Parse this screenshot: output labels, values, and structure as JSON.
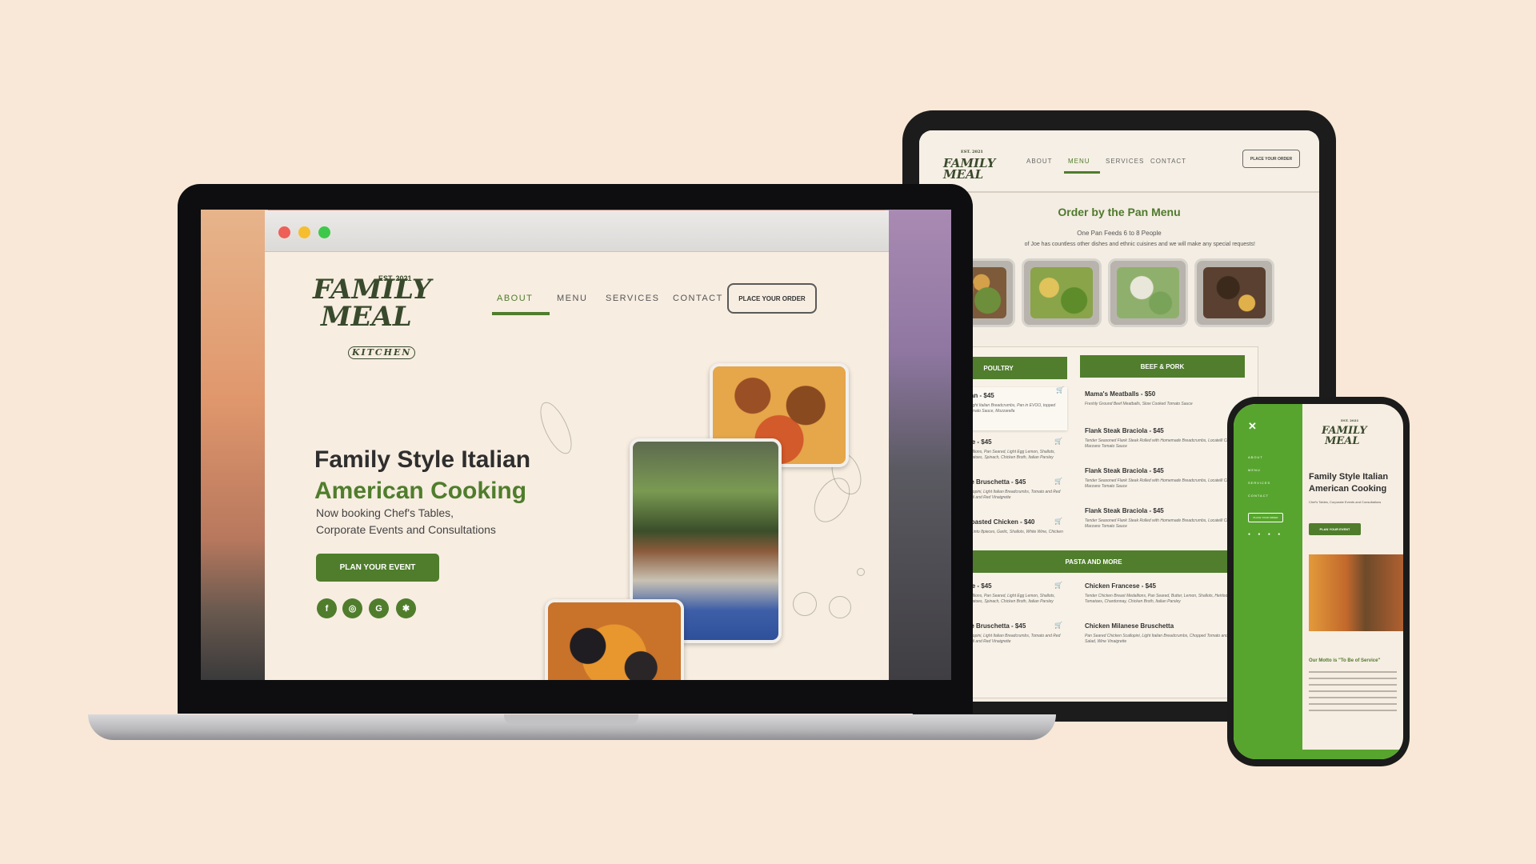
{
  "brand": {
    "est": "EST. 2021",
    "logo_line1": "FAMILY",
    "logo_line2": "MEAL",
    "logo_line3": "KITCHEN",
    "accent": "#4f7d2c",
    "background": "#f9e8d7"
  },
  "laptop": {
    "nav": [
      {
        "label": "ABOUT",
        "active": true
      },
      {
        "label": "MENU",
        "active": false
      },
      {
        "label": "SERVICES",
        "active": false
      },
      {
        "label": "CONTACT",
        "active": false
      }
    ],
    "order_button": "PLACE YOUR ORDER",
    "headline_1": "Family Style Italian",
    "headline_2": "American Cooking",
    "subtext_1": "Now booking Chef's Tables,",
    "subtext_2": "Corporate Events and Consultations",
    "cta": "PLAN YOUR EVENT",
    "social_icons": [
      "facebook-icon",
      "instagram-icon",
      "google-icon",
      "yelp-icon"
    ]
  },
  "tablet": {
    "nav": [
      {
        "label": "ABOUT",
        "active": false
      },
      {
        "label": "MENU",
        "active": true
      },
      {
        "label": "SERVICES",
        "active": false
      },
      {
        "label": "CONTACT",
        "active": false
      }
    ],
    "order_button": "PLACE YOUR ORDER",
    "title": "Order by the Pan Menu",
    "subtitle": "One Pan Feeds 6 to 8 People",
    "note": "of Joe has countless other dishes and ethnic cuisines and we will make any special requests!",
    "categories": [
      "POULTRY",
      "BEEF & PORK",
      "PASTA AND MORE"
    ],
    "poultry": [
      {
        "name": "ken Parmesan - $45",
        "desc": "Chicken Scallopini, Light Italian Breadcrumbs, Pan in EVOO, topped with San Marzano Tomato Sauce, Mozzarella"
      },
      {
        "name": "ken Francese - $45",
        "desc": "Chicken Breast Medallions, Pan Seared, Light Egg Lemon, Shallots, Heirloom Cherry Tomatoes, Spinach, Chicken Broth, Italian Parsley"
      },
      {
        "name": "ken Milanese Bruschetta - $45",
        "desc": "Seared Chicken Scallopini, Light Italian Breadcrumbs, Tomato and Red Onion Salad with Basil and Red Vinaigrette"
      },
      {
        "name": "an Lemon Roasted Chicken - $40",
        "desc": "Roasted Chicken Cut into 8pieces, Garlic, Shallots, White Wine, Chicken Broth, Fresh Herbs"
      }
    ],
    "beef_pork": [
      {
        "name": "Mama's Meatballs - $50",
        "desc": "Freshly Ground Beef Meatballs, Slow Cooked Tomato Sauce"
      },
      {
        "name": "Flank Steak Braciola - $45",
        "desc": "Tender Seasoned Flank Steak Rolled with Homemade Breadcrumbs, Locatelli Cheese, San Marzano Tomato Sauce"
      },
      {
        "name": "Flank Steak Braciola - $45",
        "desc": "Tender Seasoned Flank Steak Rolled with Homemade Breadcrumbs, Locatelli Cheese, San Marzano Tomato Sauce"
      },
      {
        "name": "Flank Steak Braciola - $45",
        "desc": "Tender Seasoned Flank Steak Rolled with Homemade Breadcrumbs, Locatelli Cheese, San Marzano Tomato Sauce"
      }
    ],
    "pasta": [
      {
        "name": "ken Francese - $45",
        "desc": "Chicken Breast Medallions, Pan Seared, Light Egg Lemon, Shallots, Heirloom Cherry Tomatoes, Spinach, Chicken Broth, Italian Parsley"
      },
      {
        "name": "Chicken Francese - $45",
        "desc": "Tender Chicken Breast Medallions, Pan Seared, Butter, Lemon, Shallots, Heirloom Cherry Tomatoes, Chardonnay, Chicken Broth, Italian Parsley"
      },
      {
        "name": "ken Milanese Bruschetta - $45",
        "desc": "Seared Chicken Scallopini, Light Italian Breadcrumbs, Tomato and Red Onion Salad with Basil and Red Vinaigrette"
      },
      {
        "name": "Chicken Milanese Bruschetta",
        "desc": "Pan Seared Chicken Scallopini, Light Italian Breadcrumbs, Chopped Tomato and Red Onion Salad, Wine Vinaigrette"
      }
    ]
  },
  "phone": {
    "close": "✕",
    "menu": [
      "ABOUT",
      "MENU",
      "SERVICES",
      "CONTACT"
    ],
    "order_button": "PLACE YOUR ORDER",
    "headline_1": "Family Style Italian",
    "headline_2": "American Cooking",
    "subtext": "Chef's Tables, Corporate Events and Consultations",
    "cta": "PLAN YOUR EVENT",
    "quote": "Our Motto is \"To Be of Service\""
  }
}
